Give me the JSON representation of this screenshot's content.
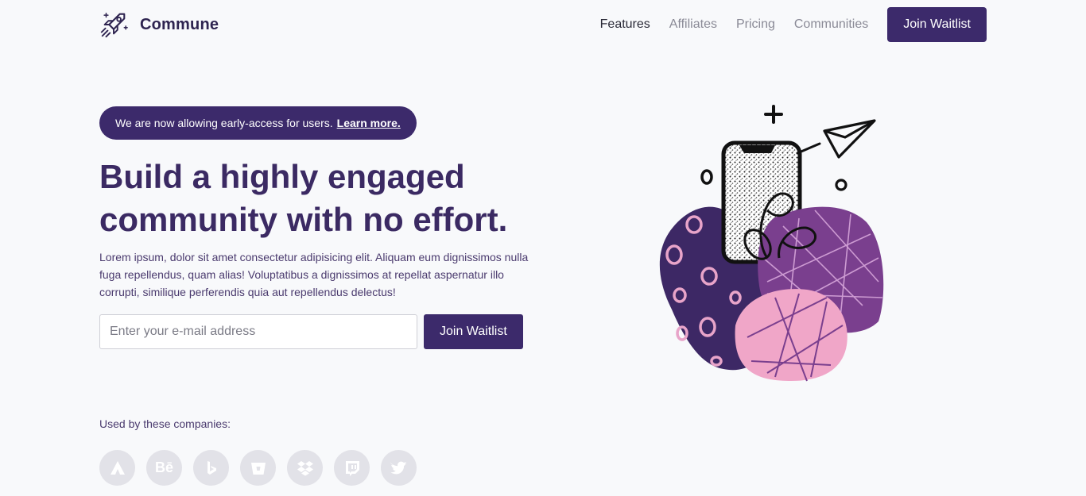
{
  "brand": {
    "name": "Commune",
    "logo_icon": "rocket-icon"
  },
  "nav": {
    "links": [
      {
        "label": "Features",
        "active": true
      },
      {
        "label": "Affiliates",
        "active": false
      },
      {
        "label": "Pricing",
        "active": false
      },
      {
        "label": "Communities",
        "active": false
      }
    ],
    "cta_label": "Join Waitlist"
  },
  "announcement": {
    "text": "We are now allowing early-access for users.",
    "link_label": "Learn more."
  },
  "hero": {
    "headline_line1": "Build a highly engaged",
    "headline_line2": "community with no effort.",
    "body": "Lorem ipsum, dolor sit amet consectetur adipisicing elit. Aliquam eum dignissimos nulla fuga repellendus, quam alias! Voluptatibus a dignissimos at repellat aspernatur illo corrupti, similique perferendis quia aut repellendus delectus!",
    "email_placeholder": "Enter your e-mail address",
    "submit_label": "Join Waitlist"
  },
  "companies": {
    "label": "Used by these companies:",
    "logos": [
      {
        "icon": "atlassian-icon",
        "glyph": ""
      },
      {
        "icon": "behance-icon",
        "glyph": "Bē"
      },
      {
        "icon": "bing-icon",
        "glyph": ""
      },
      {
        "icon": "bitbucket-icon",
        "glyph": ""
      },
      {
        "icon": "dropbox-icon",
        "glyph": ""
      },
      {
        "icon": "twitch-icon",
        "glyph": ""
      },
      {
        "icon": "twitter-icon",
        "glyph": ""
      }
    ]
  },
  "colors": {
    "primary": "#3c2a6b",
    "background": "#f8f9fb",
    "logo_grey": "#e2e2e8",
    "illustration_purple": "#7a3f8e",
    "illustration_navy": "#3d2865",
    "illustration_pink": "#f0a6c8"
  }
}
